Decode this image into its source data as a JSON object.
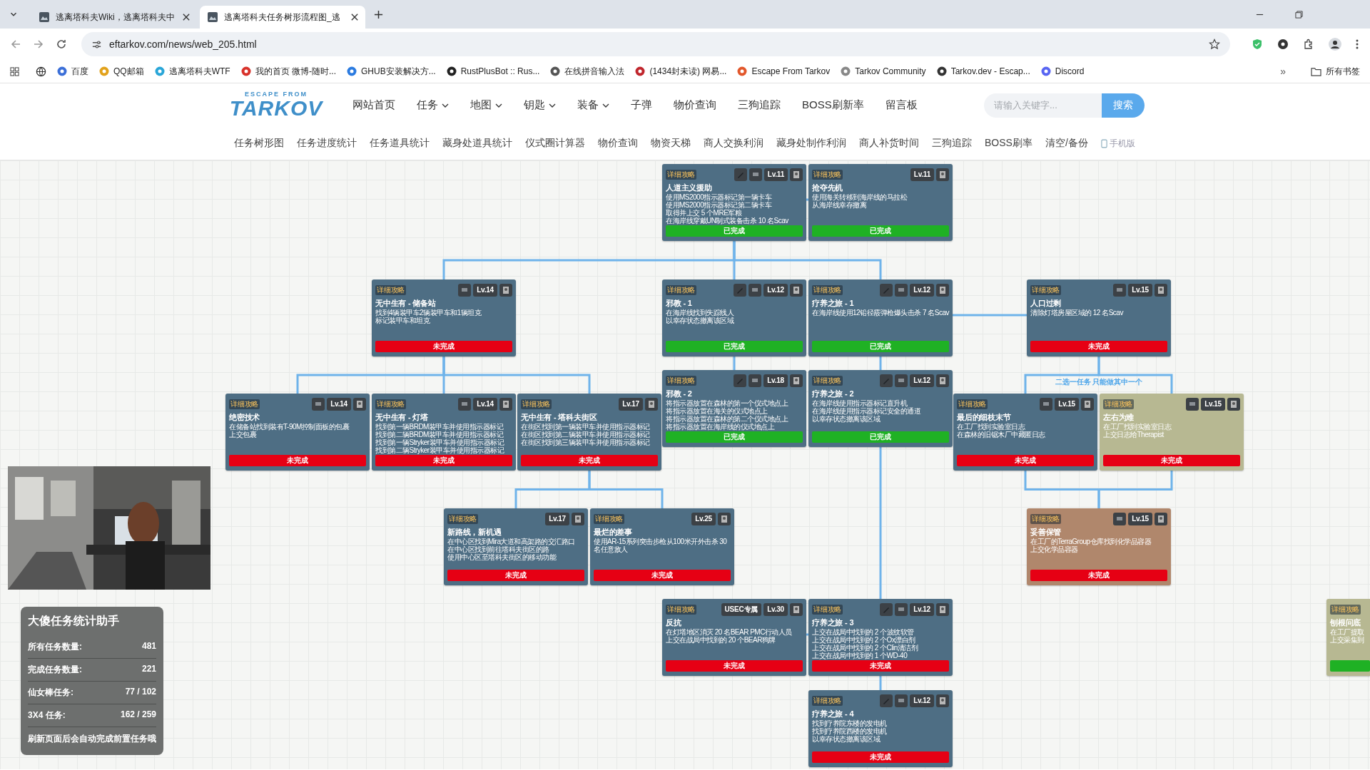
{
  "browser": {
    "tabs": [
      {
        "title": "逃离塔科夫Wiki，逃离塔科夫中",
        "selected": false
      },
      {
        "title": "逃离塔科夫任务树形流程图_逃",
        "selected": true
      }
    ],
    "address": "eftarkov.com/news/web_205.html",
    "bookmarks": [
      "百度",
      "QQ邮箱",
      "逃离塔科夫WTF",
      "我的首页 微博-随时...",
      "GHUB安装解决方...",
      "RustPlusBot :: Rus...",
      "在线拼音输入法",
      "(1434封未读) 网易...",
      "Escape From Tarkov",
      "Tarkov Community",
      "Tarkov.dev - Escap...",
      "Discord"
    ],
    "more": "»",
    "all_bookmarks": "所有书签"
  },
  "site": {
    "logo": {
      "top": "ESCAPE FROM",
      "main": "TARKOV"
    },
    "nav": [
      {
        "label": "网站首页",
        "dropdown": false
      },
      {
        "label": "任务",
        "dropdown": true
      },
      {
        "label": "地图",
        "dropdown": true
      },
      {
        "label": "钥匙",
        "dropdown": true
      },
      {
        "label": "装备",
        "dropdown": true
      },
      {
        "label": "子弹",
        "dropdown": false
      },
      {
        "label": "物价查询",
        "dropdown": false
      },
      {
        "label": "三狗追踪",
        "dropdown": false
      },
      {
        "label": "BOSS刷新率",
        "dropdown": false
      },
      {
        "label": "留言板",
        "dropdown": false
      }
    ],
    "search": {
      "placeholder": "请输入关键字...",
      "button": "搜索"
    },
    "subnav": [
      "任务树形图",
      "任务进度统计",
      "任务道具统计",
      "藏身处道具统计",
      "仪式圈计算器",
      "物价查询",
      "物资天梯",
      "商人交换利润",
      "藏身处制作利润",
      "商人补货时间",
      "三狗追踪",
      "BOSS刷率",
      "清空/备份"
    ],
    "mobile": "手机版"
  },
  "tasks": [
    {
      "guide": "详细攻略",
      "needs_item": true,
      "has_note": true,
      "level": "Lv.11",
      "title": "人道主义援助",
      "objectives": [
        "使用MS2000指示器标记第一辆卡车",
        "使用MS2000指示器标记第二辆卡车",
        "取得并上交 5 个MRE军粮",
        "在海岸线穿戴UN制式装备击杀 10 名Scav"
      ],
      "status": "已完成",
      "done": true,
      "color": "#4e6e84"
    },
    {
      "guide": "详细攻略",
      "needs_item": false,
      "has_note": false,
      "level": "Lv.11",
      "title": "抢夺先机",
      "objectives": [
        "使用海关转移到海岸线的马拉松",
        "从海岸线幸存撤离"
      ],
      "status": "已完成",
      "done": true,
      "color": "#4e6e84"
    },
    {
      "guide": "详细攻略",
      "needs_item": false,
      "has_note": true,
      "level": "Lv.14",
      "title": "无中生有 - 储备站",
      "objectives": [
        "找到4辆装甲车2辆装甲车和1辆坦克",
        "标记装甲车和坦克"
      ],
      "status": "未完成",
      "done": false,
      "color": "#4e6e84"
    },
    {
      "guide": "详细攻略",
      "needs_item": true,
      "has_note": true,
      "level": "Lv.12",
      "title": "邪教 - 1",
      "objectives": [
        "在海岸线找到失踪线人",
        "以幸存状态撤离该区域"
      ],
      "status": "已完成",
      "done": true,
      "color": "#4e6e84"
    },
    {
      "guide": "详细攻略",
      "needs_item": true,
      "has_note": true,
      "level": "Lv.12",
      "title": "疗养之旅 - 1",
      "objectives": [
        "在海岸线使用12铅径霰弹枪爆头击杀 7 名Scav"
      ],
      "status": "已完成",
      "done": true,
      "color": "#4e6e84"
    },
    {
      "guide": "详细攻略",
      "needs_item": false,
      "has_note": true,
      "level": "Lv.15",
      "title": "人口过剩",
      "objectives": [
        "清除灯塔房屋区域的 12 名Scav"
      ],
      "status": "未完成",
      "done": false,
      "color": "#4e6e84"
    },
    {
      "guide": "详细攻略",
      "needs_item": true,
      "has_note": true,
      "level": "Lv.18",
      "title": "邪教 - 2",
      "objectives": [
        "将指示器放置在森林的第一个仪式地点上",
        "将指示器放置在海关的仪式地点上",
        "将指示器放置在森林的第二个仪式地点上",
        "将指示器放置在海岸线的仪式地点上"
      ],
      "status": "已完成",
      "done": true,
      "color": "#4e6e84"
    },
    {
      "guide": "详细攻略",
      "needs_item": true,
      "has_note": true,
      "level": "Lv.12",
      "title": "疗养之旅 - 2",
      "objectives": [
        "在海岸线使用指示器标记直升机",
        "在海岸线使用指示器标记安全的通道",
        "以幸存状态撤离该区域"
      ],
      "status": "已完成",
      "done": true,
      "color": "#4e6e84"
    },
    {
      "guide": "详细攻略",
      "needs_item": false,
      "has_note": true,
      "level": "Lv.14",
      "title": "绝密技术",
      "objectives": [
        "在储备站找到装有T-90M控制面板的包裹",
        "上交包裹"
      ],
      "status": "未完成",
      "done": false,
      "color": "#4e6e84"
    },
    {
      "guide": "详细攻略",
      "needs_item": false,
      "has_note": true,
      "level": "Lv.14",
      "title": "无中生有 - 灯塔",
      "objectives": [
        "找到第一辆BRDM装甲车并使用指示器标记",
        "找到第二辆BRDM装甲车并使用指示器标记",
        "找到第一辆Stryker装甲车并使用指示器标记",
        "找到第二辆Stryker装甲车并使用指示器标记"
      ],
      "status": "未完成",
      "done": false,
      "color": "#4e6e84"
    },
    {
      "guide": "详细攻略",
      "needs_item": false,
      "has_note": false,
      "level": "Lv.17",
      "title": "无中生有 - 塔科夫街区",
      "objectives": [
        "在街区找到第一辆装甲车并使用指示器标记",
        "在街区找到第二辆装甲车并使用指示器标记",
        "在街区找到第三辆装甲车并使用指示器标记"
      ],
      "status": "未完成",
      "done": false,
      "color": "#4e6e84"
    },
    {
      "guide": "详细攻略",
      "needs_item": false,
      "has_note": true,
      "level": "Lv.15",
      "title": "最后的细枝末节",
      "objectives": [
        "在工厂找到实验室日志",
        "在森林的旧锯木厂中藏匿日志"
      ],
      "status": "未完成",
      "done": false,
      "color": "#4e6e84"
    },
    {
      "guide": "详细攻略",
      "needs_item": false,
      "has_note": true,
      "level": "Lv.15",
      "title": "左右为难",
      "objectives": [
        "在工厂找到实验室日志",
        "上交日志给Therapist"
      ],
      "status": "未完成",
      "done": false,
      "color": "#b7b892"
    },
    {
      "guide": "详细攻略",
      "needs_item": false,
      "has_note": false,
      "level": "Lv.17",
      "title": "新路线，新机遇",
      "objectives": [
        "在中心区找到Mira大道和高架路的交汇路口",
        "在中心区找到前往塔科夫街区的路",
        "使用中心区至塔科夫街区的移动功能"
      ],
      "status": "未完成",
      "done": false,
      "color": "#4e6e84"
    },
    {
      "guide": "详细攻略",
      "needs_item": false,
      "has_note": false,
      "level": "Lv.25",
      "title": "最烂的差事",
      "objectives": [
        "使用AR-15系列突击步枪从100米开外击杀 30 名任意敌人"
      ],
      "status": "未完成",
      "done": false,
      "color": "#4e6e84"
    },
    {
      "guide": "详细攻略",
      "needs_item": false,
      "has_note": true,
      "level": "Lv.15",
      "title": "妥善保管",
      "objectives": [
        "在工厂的TerraGroup仓库找到化学品容器",
        "上交化学品容器"
      ],
      "status": "未完成",
      "done": false,
      "color": "#b0876c"
    },
    {
      "guide": "详细攻略",
      "tags": [
        "USEC专属"
      ],
      "needs_item": false,
      "has_note": false,
      "level": "Lv.30",
      "title": "反抗",
      "objectives": [
        "在灯塔地区消灭 20 名BEAR PMC行动人员",
        "上交在战局中找到的 20 个BEAR狗牌"
      ],
      "status": "未完成",
      "done": false,
      "color": "#4e6e84"
    },
    {
      "guide": "详细攻略",
      "needs_item": true,
      "has_note": true,
      "level": "Lv.12",
      "title": "疗养之旅 - 3",
      "objectives": [
        "上交在战局中找到的 2 个波纹软管",
        "上交在战局中找到的 2 个Ox漂白剂",
        "上交在战局中找到的 2 个Clin清洁剂",
        "上交在战局中找到的 1 个WD-40"
      ],
      "status": "未完成",
      "done": false,
      "color": "#4e6e84"
    },
    {
      "guide": "详细攻略",
      "needs_item": true,
      "has_note": true,
      "level": "Lv.12",
      "title": "疗养之旅 - 4",
      "objectives": [
        "找到疗养院东楼的发电机",
        "找到疗养院西楼的发电机",
        "以幸存状态撤离该区域"
      ],
      "status": "未完成",
      "done": false,
      "color": "#4e6e84"
    },
    {
      "guide": "详细攻略",
      "title": "刨根问底",
      "objectives": [
        "在工厂提取",
        "上交采集到"
      ],
      "done": true,
      "color": "#b7b892"
    }
  ],
  "choice_note": "二选一任务 只能做其中一个",
  "helper": {
    "title": "大傻任务统计助手",
    "rows": [
      {
        "label": "所有任务数量:",
        "value": "481"
      },
      {
        "label": "完成任务数量:",
        "value": "221"
      },
      {
        "label": "仙女棒任务:",
        "value": "77 / 102"
      },
      {
        "label": "3X4 任务:",
        "value": "162 / 259"
      }
    ],
    "note": "刷新页面后会自动完成前置任务哦"
  }
}
